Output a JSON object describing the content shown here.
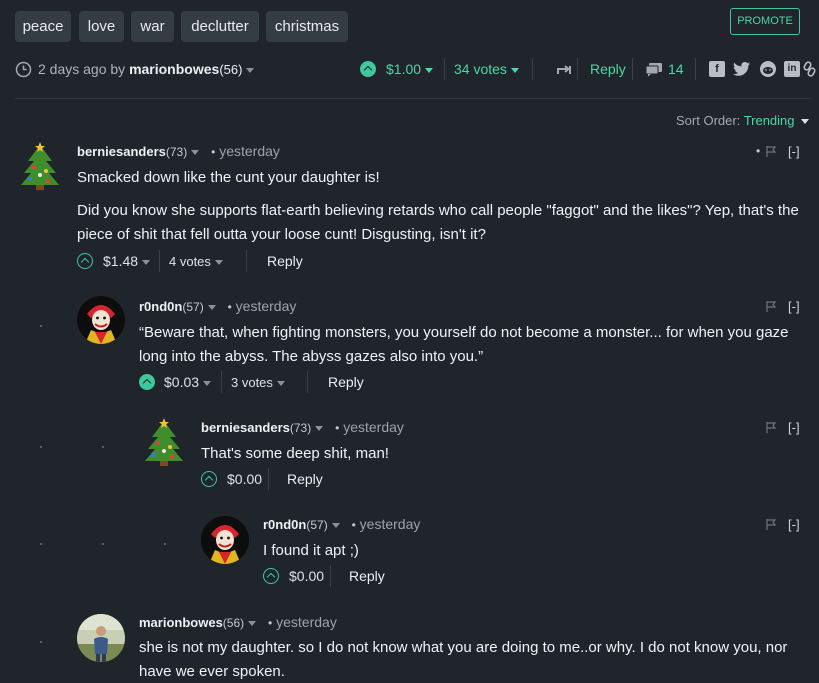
{
  "tags": [
    "peace",
    "love",
    "war",
    "declutter",
    "christmas"
  ],
  "promote_label": "PROMOTE",
  "post_meta": {
    "time": "2 days ago by",
    "author": "marionbowes",
    "author_rep": "(56)",
    "payout": "$1.00",
    "votes": "34 votes",
    "reply": "Reply",
    "comment_count": "14"
  },
  "sort": {
    "label": "Sort Order:",
    "value": "Trending"
  },
  "comments": [
    {
      "author": "berniesanders",
      "rep": "(73)",
      "time": "yesterday",
      "collapse": "[-]",
      "body1": "Smacked down like the cunt your daughter is!",
      "body2_line1": "Did you know she supports flat-earth believing retards who call people \"faggot\" and the likes\"? Yep, that's the",
      "body2_line2": "piece of shit that fell outta your loose cunt! Disgusting, isn't it?",
      "payout": "$1.48",
      "votes": "4 votes",
      "reply": "Reply"
    },
    {
      "author": "r0nd0n",
      "rep": "(57)",
      "time": "yesterday",
      "collapse": "[-]",
      "body_line1": "“Beware that, when fighting monsters, you yourself do not become a monster... for when you gaze",
      "body_line2": "long into the abyss. The abyss gazes also into you.”",
      "payout": "$0.03",
      "votes": "3 votes",
      "reply": "Reply"
    },
    {
      "author": "berniesanders",
      "rep": "(73)",
      "time": "yesterday",
      "collapse": "[-]",
      "body": "That's some deep shit, man!",
      "payout": "$0.00",
      "reply": "Reply"
    },
    {
      "author": "r0nd0n",
      "rep": "(57)",
      "time": "yesterday",
      "collapse": "[-]",
      "body": "I found it apt ;)",
      "payout": "$0.00",
      "reply": "Reply"
    },
    {
      "author": "marionbowes",
      "rep": "(56)",
      "time": "yesterday",
      "body_line1": "she is not my daughter. so I do not know what you are doing to me..or why. I do not know you, nor",
      "body_line2": "have we ever spoken."
    }
  ],
  "dot_separator": "•",
  "colors": {
    "background": "#1f252b",
    "accent": "#3dc99c",
    "tag_bg": "#343c44"
  },
  "icons": [
    "clock-icon",
    "upvote-icon",
    "resteem-icon",
    "comment-icon",
    "facebook-icon",
    "twitter-icon",
    "reddit-icon",
    "linkedin-icon",
    "link-icon",
    "flag-icon",
    "christmas-tree-avatar",
    "clown-avatar",
    "user-photo-avatar"
  ]
}
